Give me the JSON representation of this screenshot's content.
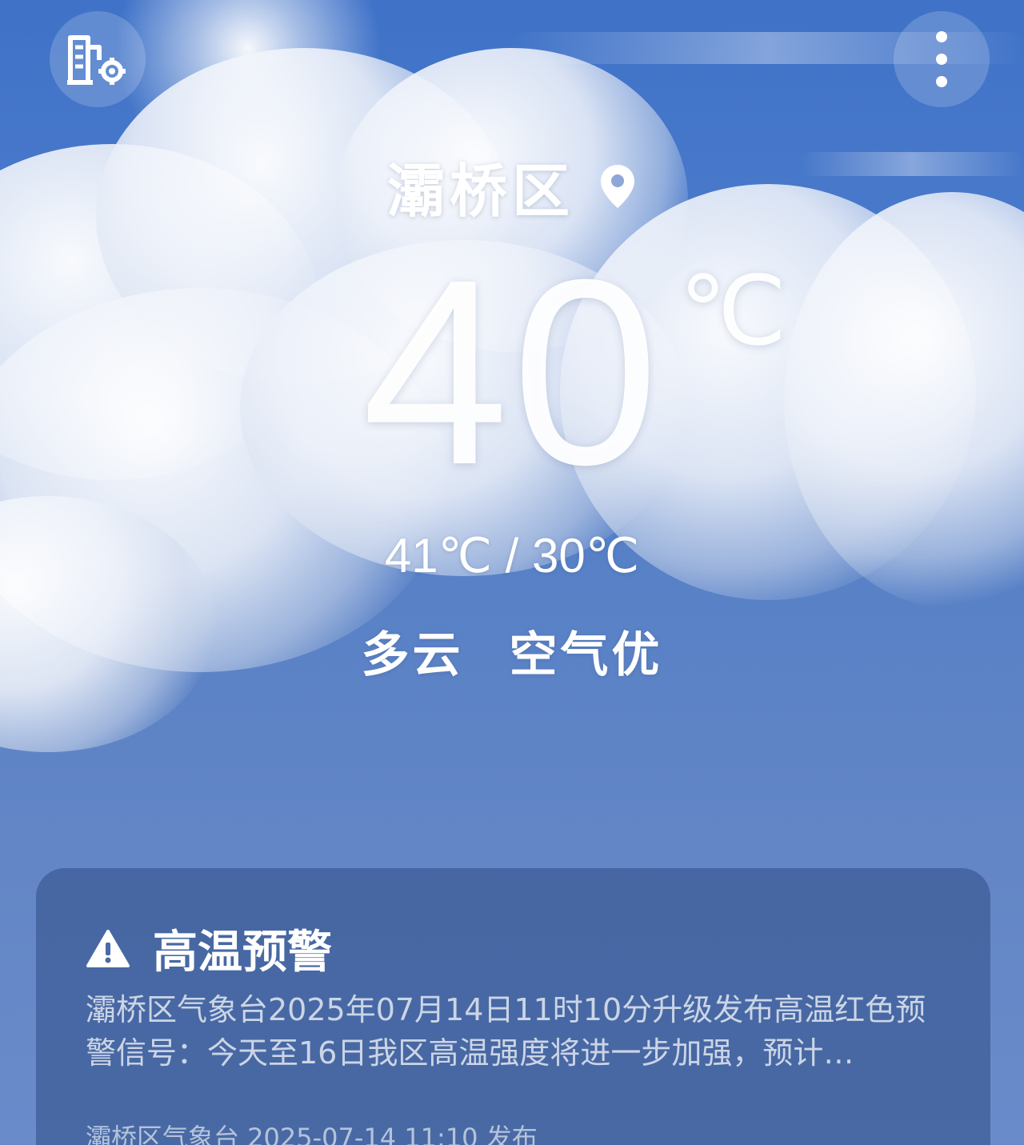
{
  "location": {
    "city": "灞桥区"
  },
  "current": {
    "temperature": "40",
    "unit": "℃",
    "high_low": "41℃ / 30℃",
    "condition": "多云",
    "air_quality": "空气优"
  },
  "alert": {
    "title": "高温预警",
    "body": "灞桥区气象台2025年07月14日11时10分升级发布高温红色预警信号：今天至16日我区高温强度将进一步加强，预计…",
    "source": "灞桥区气象台 2025-07-14 11:10 发布"
  },
  "icons": {
    "city_manage": "city-settings-icon",
    "more": "more-vertical-icon",
    "location": "location-pin-icon",
    "warning": "warning-triangle-icon"
  }
}
